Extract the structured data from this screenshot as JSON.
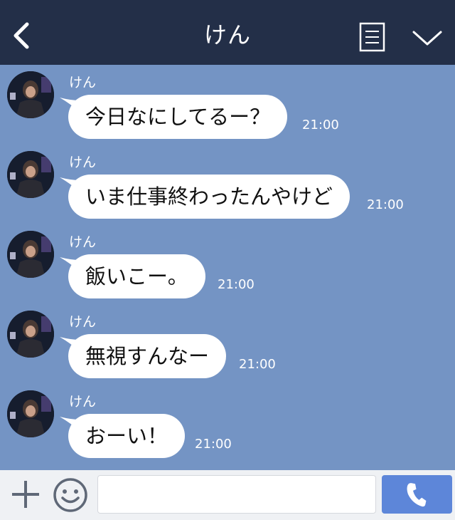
{
  "header": {
    "title": "けん",
    "back_icon": "chevron-left-icon",
    "menu_icon": "list-icon",
    "collapse_icon": "chevron-down-icon"
  },
  "messages": [
    {
      "sender": "けん",
      "text": "今日なにしてるー？",
      "time": "21:00"
    },
    {
      "sender": "けん",
      "text": "いま仕事終わったんやけど",
      "time": "21:00"
    },
    {
      "sender": "けん",
      "text": "飯いこー。",
      "time": "21:00"
    },
    {
      "sender": "けん",
      "text": "無視すんなー",
      "time": "21:00"
    },
    {
      "sender": "けん",
      "text": "おーい！",
      "time": "21:00"
    }
  ],
  "input_bar": {
    "plus_icon": "plus-icon",
    "emoji_icon": "smiley-icon",
    "message_value": "",
    "call_icon": "phone-icon"
  },
  "colors": {
    "header_bg": "#232f48",
    "chat_bg": "#7494c4",
    "bubble_bg": "#ffffff",
    "call_button": "#5d86d9"
  }
}
